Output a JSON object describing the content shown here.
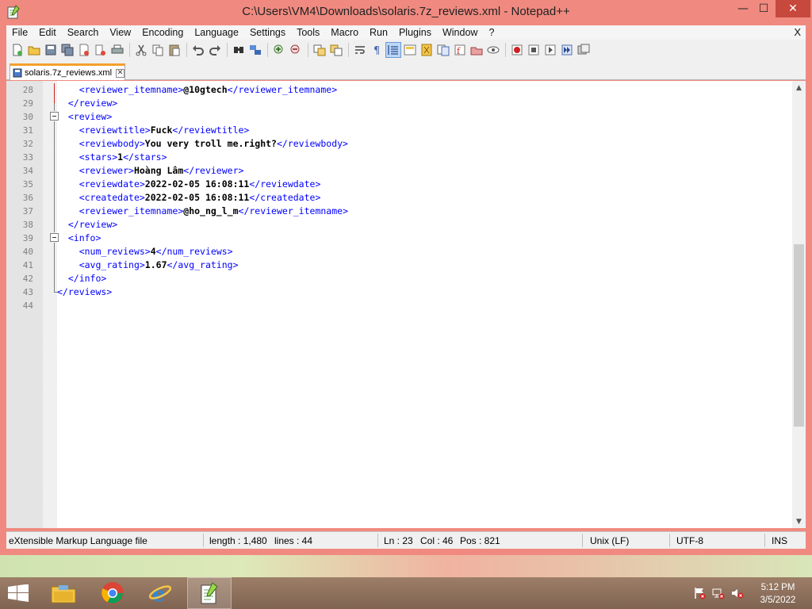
{
  "window": {
    "title": "C:\\Users\\VM4\\Downloads\\solaris.7z_reviews.xml - Notepad++",
    "minimize_glyph": "—",
    "maximize_glyph": "☐",
    "close_glyph": "✕"
  },
  "menu": {
    "items": [
      "File",
      "Edit",
      "Search",
      "View",
      "Encoding",
      "Language",
      "Settings",
      "Tools",
      "Macro",
      "Run",
      "Plugins",
      "Window",
      "?"
    ],
    "close_label": "X"
  },
  "toolbar": {
    "icons": [
      "new-file-icon",
      "open-file-icon",
      "save-icon",
      "save-all-icon",
      "close-icon",
      "close-all-icon",
      "print-icon",
      "cut-icon",
      "copy-icon",
      "paste-icon",
      "undo-icon",
      "redo-icon",
      "find-icon",
      "replace-icon",
      "zoom-in-icon",
      "zoom-out-icon",
      "sync-vertical-icon",
      "sync-horizontal-icon",
      "word-wrap-icon",
      "show-all-chars-icon",
      "indent-guide-icon",
      "user-language-icon",
      "doc-map-icon",
      "function-list-icon",
      "folder-as-workspace-icon",
      "monitoring-icon",
      "record-macro-icon",
      "stop-record-icon",
      "play-macro-icon",
      "run-macro-multiple-icon",
      "save-macro-icon"
    ]
  },
  "tabs": [
    {
      "label": "solaris.7z_reviews.xml",
      "close_glyph": "✕"
    }
  ],
  "editor": {
    "lines": [
      {
        "num": "28",
        "indent": "    ",
        "open": "<reviewer_itemname>",
        "text": "@10gtech",
        "close": "</reviewer_itemname>"
      },
      {
        "num": "29",
        "indent": "  ",
        "open": "</review>",
        "text": "",
        "close": ""
      },
      {
        "num": "30",
        "indent": "  ",
        "open": "<review>",
        "text": "",
        "close": ""
      },
      {
        "num": "31",
        "indent": "    ",
        "open": "<reviewtitle>",
        "text": "Fuck",
        "close": "</reviewtitle>"
      },
      {
        "num": "32",
        "indent": "    ",
        "open": "<reviewbody>",
        "text": "You very troll me.right?",
        "close": "</reviewbody>"
      },
      {
        "num": "33",
        "indent": "    ",
        "open": "<stars>",
        "text": "1",
        "close": "</stars>"
      },
      {
        "num": "34",
        "indent": "    ",
        "open": "<reviewer>",
        "text": "Hoàng Lâm",
        "close": "</reviewer>"
      },
      {
        "num": "35",
        "indent": "    ",
        "open": "<reviewdate>",
        "text": "2022-02-05 16:08:11",
        "close": "</reviewdate>"
      },
      {
        "num": "36",
        "indent": "    ",
        "open": "<createdate>",
        "text": "2022-02-05 16:08:11",
        "close": "</createdate>"
      },
      {
        "num": "37",
        "indent": "    ",
        "open": "<reviewer_itemname>",
        "text": "@ho_ng_l_m",
        "close": "</reviewer_itemname>"
      },
      {
        "num": "38",
        "indent": "  ",
        "open": "</review>",
        "text": "",
        "close": ""
      },
      {
        "num": "39",
        "indent": "  ",
        "open": "<info>",
        "text": "",
        "close": ""
      },
      {
        "num": "40",
        "indent": "    ",
        "open": "<num_reviews>",
        "text": "4",
        "close": "</num_reviews>"
      },
      {
        "num": "41",
        "indent": "    ",
        "open": "<avg_rating>",
        "text": "1.67",
        "close": "</avg_rating>"
      },
      {
        "num": "42",
        "indent": "  ",
        "open": "</info>",
        "text": "",
        "close": ""
      },
      {
        "num": "43",
        "indent": "",
        "open": "</reviews>",
        "text": "",
        "close": ""
      },
      {
        "num": "44",
        "indent": "",
        "open": "",
        "text": "",
        "close": ""
      }
    ]
  },
  "statusbar": {
    "file_type": "eXtensible Markup Language file",
    "length": "length : 1,480",
    "lines": "lines : 44",
    "ln": "Ln : 23",
    "col": "Col : 46",
    "pos": "Pos : 821",
    "eol": "Unix (LF)",
    "encoding": "UTF-8",
    "mode": "INS"
  },
  "taskbar": {
    "apps": [
      "file-explorer-icon",
      "chrome-icon",
      "internet-explorer-icon",
      "notepadpp-icon"
    ],
    "time": "5:12 PM",
    "date": "3/5/2022"
  },
  "colors": {
    "title_bar": "#f08a80",
    "xml_tag": "#0000ff",
    "tab_accent": "#f4a02c",
    "close_button": "#c7483d"
  }
}
